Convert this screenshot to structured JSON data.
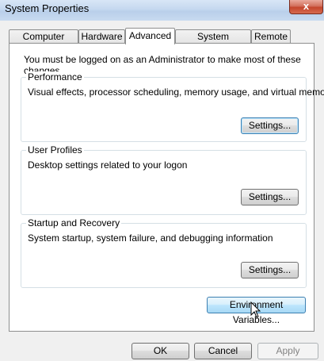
{
  "window": {
    "title": "System Properties",
    "close_glyph": "x"
  },
  "tabs": [
    {
      "label": "Computer Name"
    },
    {
      "label": "Hardware"
    },
    {
      "label": "Advanced"
    },
    {
      "label": "System Protection"
    },
    {
      "label": "Remote"
    }
  ],
  "active_tab": "Advanced",
  "intro": "You must be logged on as an Administrator to make most of these changes.",
  "groups": {
    "performance": {
      "title": "Performance",
      "desc": "Visual effects, processor scheduling, memory usage, and virtual memory",
      "button": "Settings..."
    },
    "profiles": {
      "title": "User Profiles",
      "desc": "Desktop settings related to your logon",
      "button": "Settings..."
    },
    "startup": {
      "title": "Startup and Recovery",
      "desc": "System startup, system failure, and debugging information",
      "button": "Settings..."
    }
  },
  "env_button": "Environment Variables...",
  "dialog_buttons": {
    "ok": "OK",
    "cancel": "Cancel",
    "apply": "Apply"
  },
  "colors": {
    "close": "#c4452c",
    "hover_blue": "#3c7fb1"
  }
}
